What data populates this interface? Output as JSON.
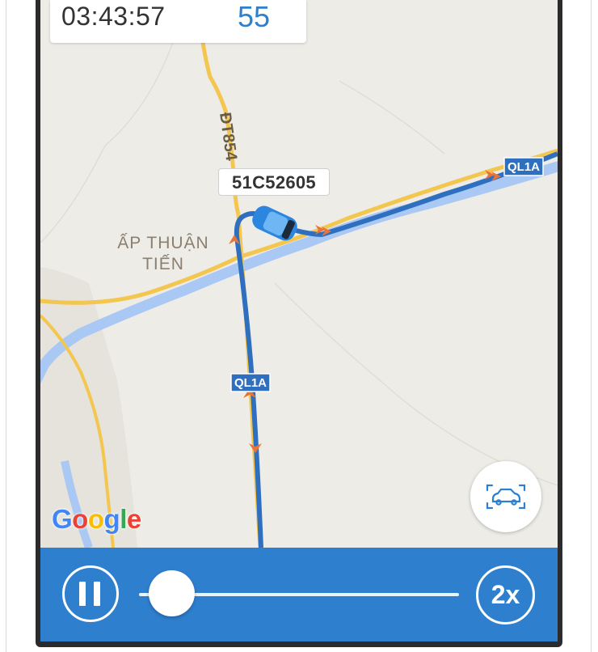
{
  "info_card": {
    "time": "03:43:57",
    "speed": "55"
  },
  "vehicle": {
    "plate": "51C52605"
  },
  "map": {
    "road_labels": [
      "ĐT854",
      "QL1A",
      "QL1A"
    ],
    "place_label_line1": "ẤP THUẬN",
    "place_label_line2": "TIẾN",
    "attribution_letters": [
      "G",
      "o",
      "o",
      "g",
      "l",
      "e"
    ]
  },
  "controls": {
    "speed_multiplier": "2x",
    "playback_progress": 0.1
  },
  "colors": {
    "accent": "#2f7fcf",
    "route": "#2f6fc0",
    "marker": "#e8743b",
    "map_background": "#eeece6",
    "river": "#a9c8f3",
    "road": "#f3c650"
  },
  "icons": {
    "pause": "pause-icon",
    "focus_vehicle": "car-focus-icon",
    "vehicle": "car-icon"
  }
}
